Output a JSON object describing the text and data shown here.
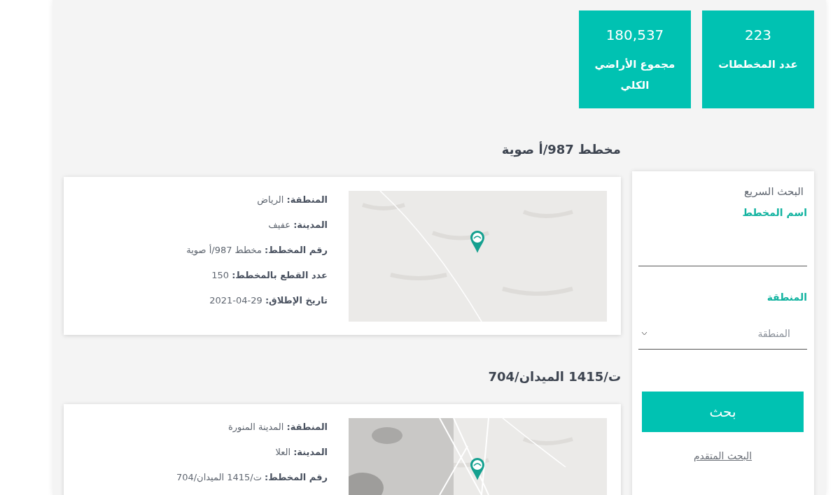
{
  "stats": [
    {
      "value": "223",
      "label": "عدد المخططات"
    },
    {
      "value": "180,537",
      "label": "مجموع الأراضي الكلي"
    }
  ],
  "plans": [
    {
      "title": "مخطط 987/أ صوية",
      "details": [
        "**المنطقة:** الرياض",
        "**المدينة:** عفيف",
        "**رقم المخطط:** مخطط 987/أ صوية",
        "**عدد القطع بالمخطط:** 150",
        "**تاريخ الإطلاق:** 29-04-2021"
      ]
    },
    {
      "title": "ت/1415 الميدان/704",
      "details": [
        "**المنطقة:** المدينة المنورة",
        "**المدينة:** العلا",
        "**رقم المخطط:** ت/1415 الميدان/704"
      ]
    }
  ],
  "quick_search": {
    "title": "البحث السريع",
    "fields": [
      {
        "kind": "text",
        "label": "اسم المخطط"
      },
      {
        "kind": "select",
        "label": "المنطقة",
        "placeholder": "المنطقة"
      }
    ],
    "button": "بحث",
    "advanced_link": "البحث المتقدم"
  }
}
